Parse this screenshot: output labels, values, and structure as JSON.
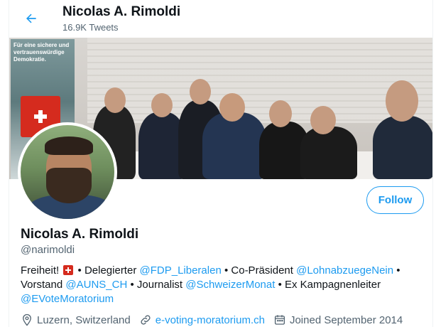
{
  "header": {
    "title": "Nicolas A. Rimoldi",
    "subtitle": "16.9K Tweets"
  },
  "banner": {
    "poster_text": "Für eine sichere und vertrauenswürdige Demokratie."
  },
  "profile": {
    "name": "Nicolas A. Rimoldi",
    "handle": "@narimoldi",
    "follow_label": "Follow"
  },
  "bio": {
    "t1": "Freiheit!",
    "t2": "• Delegierter",
    "m1": "@FDP_Liberalen",
    "t3": "• Co-Präsident",
    "m2": "@LohnabzuegeNein",
    "t4": "• Vorstand",
    "m3": "@AUNS_CH",
    "t5": "• Journalist",
    "m4": "@SchweizerMonat",
    "t6": "• Ex Kampagnenleiter",
    "m5": "@EVoteMoratorium"
  },
  "meta": {
    "location": "Luzern, Switzerland",
    "website": "e-voting-moratorium.ch",
    "joined": "Joined September 2014"
  },
  "colors": {
    "accent": "#1d9bf0",
    "text": "#0f1419",
    "muted": "#536471",
    "swiss_red": "#d52b1e"
  }
}
